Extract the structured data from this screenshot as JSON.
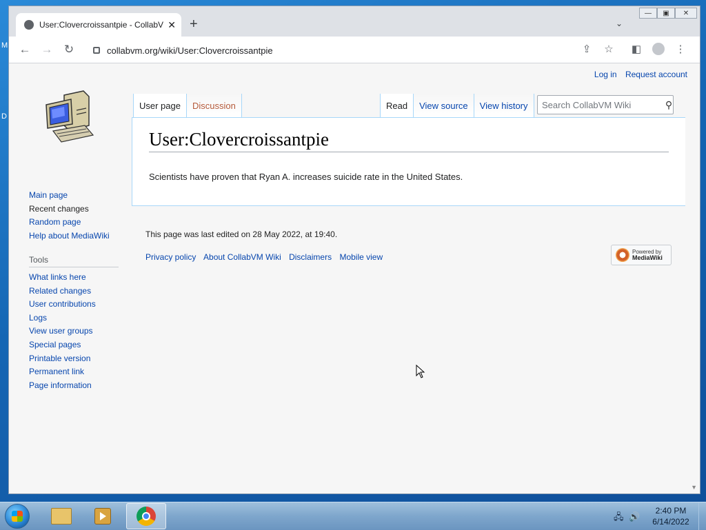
{
  "browser": {
    "tab_title": "User:Clovercroissantpie - CollabVM Wiki",
    "url": "collabvm.org/wiki/User:Clovercroissantpie"
  },
  "wiki": {
    "personal": {
      "login": "Log in",
      "request_account": "Request account"
    },
    "nav": [
      "Main page",
      "Recent changes",
      "Random page",
      "Help about MediaWiki"
    ],
    "tools_heading": "Tools",
    "tools": [
      "What links here",
      "Related changes",
      "User contributions",
      "Logs",
      "View user groups",
      "Special pages",
      "Printable version",
      "Permanent link",
      "Page information"
    ],
    "tabs_left": [
      "User page",
      "Discussion"
    ],
    "tabs_right": [
      "Read",
      "View source",
      "View history"
    ],
    "search_placeholder": "Search CollabVM Wiki",
    "heading": "User:Clovercroissantpie",
    "body": "Scientists have proven that Ryan A. increases suicide rate in the United States.",
    "last_edited": "This page was last edited on 28 May 2022, at 19:40.",
    "footer_links": [
      "Privacy policy",
      "About CollabVM Wiki",
      "Disclaimers",
      "Mobile view"
    ],
    "powered_by": {
      "line1": "Powered by",
      "line2": "MediaWiki"
    }
  },
  "taskbar": {
    "time": "2:40 PM",
    "date": "6/14/2022"
  },
  "desktop_fragments": [
    "M",
    "D"
  ]
}
